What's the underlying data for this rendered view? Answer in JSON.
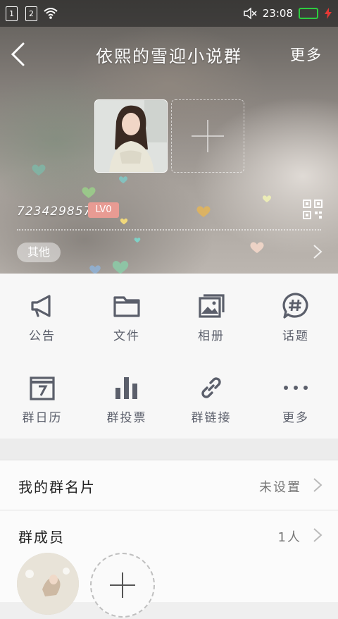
{
  "status_bar": {
    "sim1": "1",
    "sim2": "2",
    "time": "23:08",
    "icons": [
      "wifi-icon",
      "mute-icon",
      "battery-icon",
      "charging-icon"
    ]
  },
  "header": {
    "title": "依熙的雪迎小说群",
    "more": "更多"
  },
  "group": {
    "id": "723429857",
    "level": "LV0",
    "category": "其他"
  },
  "tools": [
    {
      "label": "公告",
      "icon": "megaphone-icon"
    },
    {
      "label": "文件",
      "icon": "folder-icon"
    },
    {
      "label": "相册",
      "icon": "album-icon"
    },
    {
      "label": "话题",
      "icon": "hashtag-chat-icon"
    },
    {
      "label": "群日历",
      "icon": "calendar-icon"
    },
    {
      "label": "群投票",
      "icon": "bar-chart-icon"
    },
    {
      "label": "群链接",
      "icon": "link-icon"
    },
    {
      "label": "更多",
      "icon": "more-dots-icon"
    }
  ],
  "card": {
    "label": "我的群名片",
    "value": "未设置"
  },
  "members": {
    "label": "群成员",
    "count": "1人"
  },
  "colors": {
    "icon": "#5b5f6b",
    "level_badge": "#e89b93",
    "battery": "#2ecc40",
    "charge": "#e53935"
  }
}
